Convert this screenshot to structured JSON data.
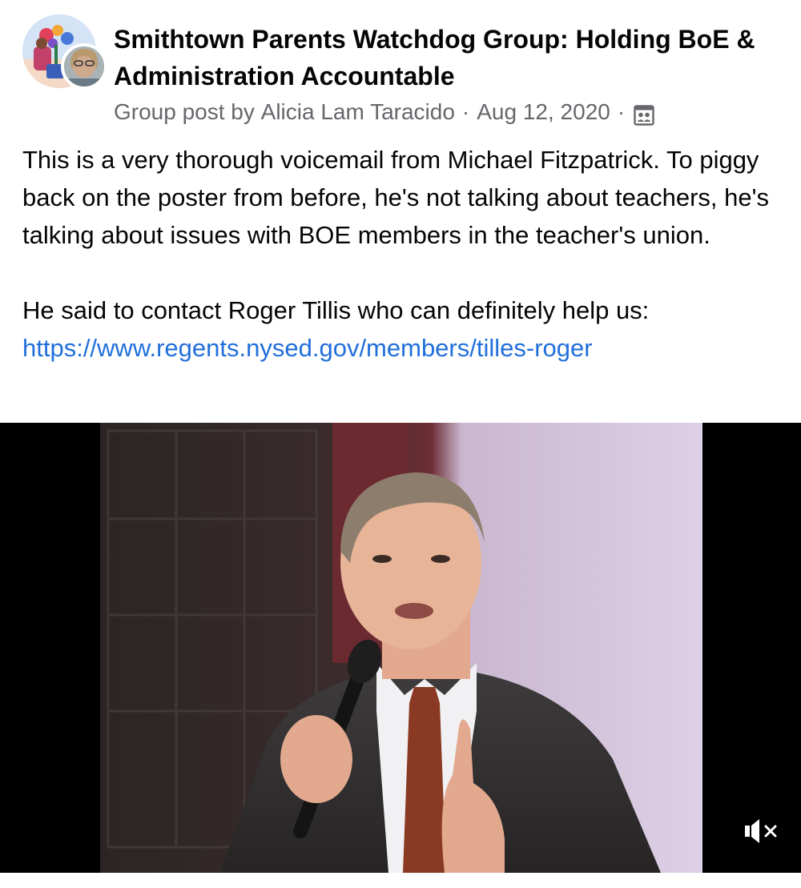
{
  "group": {
    "name": "Smithtown Parents Watchdog Group: Holding BoE & Administration Accountable"
  },
  "meta": {
    "prefix": "Group post by",
    "author": "Alicia Lam Taracido",
    "separator": "·",
    "date": "Aug 12, 2020",
    "privacy_icon": "group-members-icon"
  },
  "post": {
    "paragraph_1": "This is a very thorough voicemail from Michael Fitzpatrick. To piggy back on the poster from before, he's not talking about teachers, he's talking about issues with BOE members in the teacher's union.",
    "paragraph_2": "He said to contact Roger Tillis who can definitely help us:",
    "link": "https://www.regents.nysed.gov/members/tilles-roger"
  },
  "media": {
    "type": "video",
    "muted": true,
    "mute_icon": "speaker-muted-icon"
  },
  "colors": {
    "link": "#216fdb",
    "meta_text": "#65676b",
    "title_text": "#050505",
    "media_letterbox": "#000000"
  }
}
